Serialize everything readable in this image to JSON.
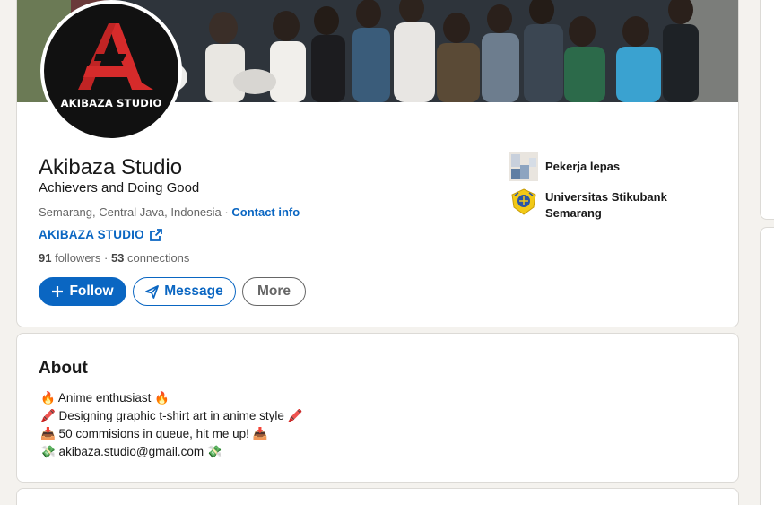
{
  "profile": {
    "name": "Akibaza Studio",
    "headline": "Achievers and Doing Good",
    "location": "Semarang, Central Java, Indonesia",
    "separator": " · ",
    "contact_info": "Contact info",
    "website": "AKIBAZA STUDIO",
    "followers_count": "91",
    "followers_label": " followers",
    "dot": " · ",
    "connections_count": "53",
    "connections_label": " connections",
    "avatar_caption": "AKIBAZA STUDIO",
    "brand_color": "#d62b2b"
  },
  "actions": {
    "follow": "Follow",
    "message": "Message",
    "more": "More"
  },
  "affiliations": [
    {
      "label": "Pekerja lepas",
      "icon": "company-placeholder-icon"
    },
    {
      "label": "Universitas Stikubank Semarang",
      "icon": "university-crest-icon"
    }
  ],
  "about": {
    "title": "About",
    "lines": [
      "🔥 Anime enthusiast 🔥",
      "🖍️ Designing graphic t-shirt art in anime style 🖍️",
      "📥 50 commisions in queue, hit me up! 📥",
      "💸  akibaza.studio@gmail.com 💸"
    ]
  },
  "colors": {
    "accent": "#0a66c2",
    "page_bg": "#f4f2ee"
  }
}
